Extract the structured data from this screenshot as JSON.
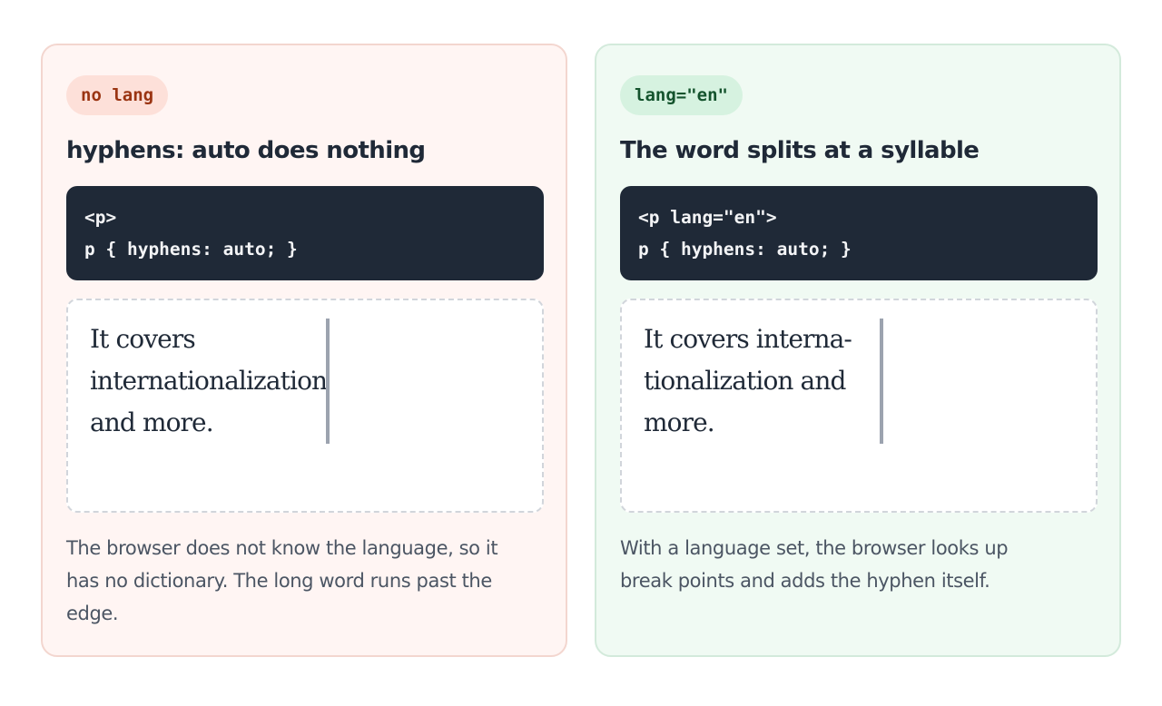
{
  "cards": [
    {
      "badge": "no lang",
      "title": "hyphens: auto does nothing",
      "code_lines": [
        "<p>",
        "p { hyphens: auto; }"
      ],
      "demo_lines": [
        "It covers",
        "internationalization",
        "and more."
      ],
      "note_lines": [
        "The browser does not know the language, so it",
        "has no dictionary. The long word runs past the",
        "edge."
      ]
    },
    {
      "badge": "lang=\"en\"",
      "title": "The word splits at a syllable",
      "code_lines": [
        "<p lang=\"en\">",
        "p { hyphens: auto; }"
      ],
      "demo_lines": [
        "It covers interna-",
        "tionalization and",
        "more."
      ],
      "note_lines": [
        "With a language set, the browser looks up",
        "break points and adds the hyphen itself."
      ]
    }
  ],
  "colors": {
    "bad_card_bg": "#fff5f3",
    "bad_badge_bg": "#fde0d9",
    "bad_badge_text": "#9a3412",
    "good_card_bg": "#f0faf3",
    "good_badge_bg": "#d6f2e0",
    "good_badge_text": "#14532d",
    "code_bg": "#1f2937"
  }
}
